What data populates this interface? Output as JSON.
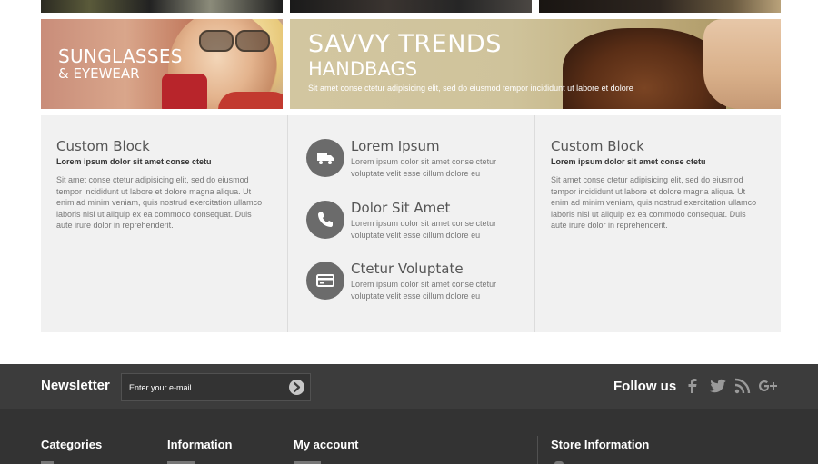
{
  "banners": {
    "sunglasses": {
      "line1": "SUNGLASSES",
      "line2": "& EYEWEAR"
    },
    "handbags": {
      "line1": "SAVVY TRENDS",
      "line2": "HANDBAGS",
      "text": "Sit amet conse ctetur adipisicing elit, sed do eiusmod tempor incididunt ut labore et dolore"
    }
  },
  "cms": {
    "left": {
      "title": "Custom Block",
      "subtitle": "Lorem ipsum dolor sit amet conse ctetu",
      "text": "Sit amet conse ctetur adipisicing elit, sed do eiusmod tempor incididunt ut labore et dolore magna aliqua. Ut enim ad minim veniam, quis nostrud exercitation ullamco laboris nisi ut aliquip ex ea commodo consequat. Duis aute irure dolor in reprehenderit."
    },
    "services": [
      {
        "title": "Lorem Ipsum",
        "text": "Lorem ipsum dolor sit amet conse ctetur voluptate velit esse cillum dolore eu",
        "icon": "truck-icon"
      },
      {
        "title": "Dolor Sit Amet",
        "text": "Lorem ipsum dolor sit amet conse ctetur voluptate velit esse cillum dolore eu",
        "icon": "phone-icon"
      },
      {
        "title": "Ctetur Voluptate",
        "text": "Lorem ipsum dolor sit amet conse ctetur voluptate velit esse cillum dolore eu",
        "icon": "credit-card-icon"
      }
    ],
    "right": {
      "title": "Custom Block",
      "subtitle": "Lorem ipsum dolor sit amet conse ctetu",
      "text": "Sit amet conse ctetur adipisicing elit, sed do eiusmod tempor incididunt ut labore et dolore magna aliqua. Ut enim ad minim veniam, quis nostrud exercitation ullamco laboris nisi ut aliquip ex ea commodo consequat. Duis aute irure dolor in reprehenderit."
    }
  },
  "newsletter": {
    "label": "Newsletter",
    "placeholder": "Enter your e-mail",
    "value": ""
  },
  "follow": {
    "label": "Follow us",
    "networks": [
      "facebook-icon",
      "twitter-icon",
      "rss-icon",
      "google-plus-icon"
    ]
  },
  "footer": {
    "headings": [
      "Categories",
      "Information",
      "My account",
      "Store Information"
    ]
  },
  "colors": {
    "footer_dark": "#333333",
    "newsletter_bar": "#3c3c3c",
    "cms_bg": "#f1f1f1",
    "icon_circle": "#6b6b6b"
  }
}
